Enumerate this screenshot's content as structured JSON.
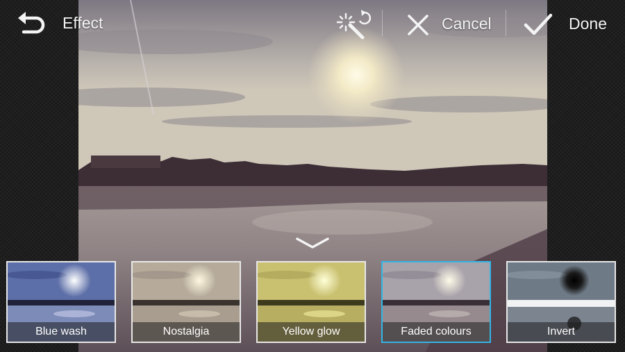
{
  "header": {
    "title": "Effect",
    "cancel_label": "Cancel",
    "done_label": "Done"
  },
  "icons": {
    "back": "back-arrow-icon",
    "tools": "magic-wand-undo-icon",
    "cancel": "close-icon",
    "done": "checkmark-icon",
    "collapse": "chevron-down-icon"
  },
  "effects": [
    {
      "label": "Blue wash",
      "selected": false
    },
    {
      "label": "Nostalgia",
      "selected": false
    },
    {
      "label": "Yellow glow",
      "selected": false
    },
    {
      "label": "Faded colours",
      "selected": true
    },
    {
      "label": "Invert",
      "selected": false
    }
  ],
  "colors": {
    "accent": "#33b5e5",
    "background": "#1e1e1e"
  }
}
